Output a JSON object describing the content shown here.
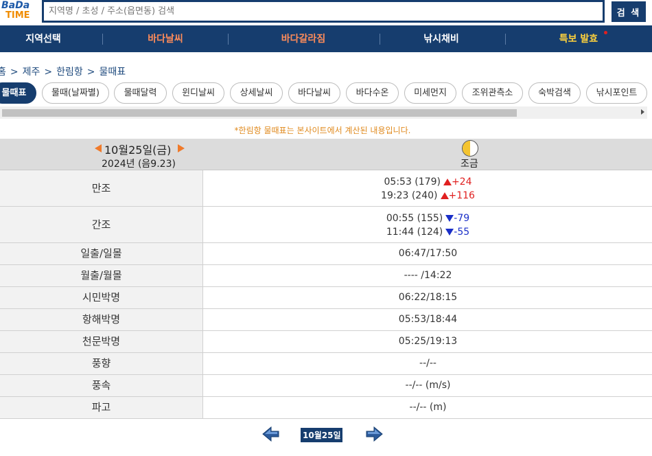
{
  "logo": {
    "line1": "BaDa",
    "line2": "TIME"
  },
  "search": {
    "placeholder": "지역명 / 초성 / 주소(읍면동) 검색",
    "button": "검 색"
  },
  "nav": {
    "items": [
      {
        "label": "지역선택",
        "color": "#ffffff"
      },
      {
        "label": "바다날씨",
        "color": "#ff8c5a"
      },
      {
        "label": "바다갈라짐",
        "color": "#ff8c5a"
      },
      {
        "label": "낚시채비",
        "color": "#ffffff"
      },
      {
        "label": "특보 발효",
        "color": "#ffd23c"
      }
    ]
  },
  "breadcrumb": [
    "홈",
    ">",
    "제주",
    ">",
    "한림항",
    ">",
    "물때표"
  ],
  "tabs": [
    "물때표",
    "물때(날짜별)",
    "물때달력",
    "윈디날씨",
    "상세날씨",
    "바다날씨",
    "바다수온",
    "미세먼지",
    "조위관측소",
    "숙박검색",
    "낚시포인트"
  ],
  "notice": "*한림항 물때표는 본사이트에서 계산된 내용입니다.",
  "date_header": {
    "date": "10월25일(금)",
    "sub": "2024년 (음9.23)",
    "moon_phase": "조금"
  },
  "tide": {
    "high_label": "만조",
    "high": [
      {
        "time": "05:53 (179)",
        "delta": "+24"
      },
      {
        "time": "19:23 (240)",
        "delta": "+116"
      }
    ],
    "low_label": "간조",
    "low": [
      {
        "time": "00:55 (155)",
        "delta": "-79"
      },
      {
        "time": "11:44 (124)",
        "delta": "-55"
      }
    ]
  },
  "rows": [
    {
      "label": "일출/일몰",
      "value": "06:47/17:50"
    },
    {
      "label": "월출/월몰",
      "value": "---- /14:22"
    },
    {
      "label": "시민박명",
      "value": "06:22/18:15"
    },
    {
      "label": "항해박명",
      "value": "05:53/18:44"
    },
    {
      "label": "천문박명",
      "value": "05:25/19:13"
    },
    {
      "label": "풍향",
      "value": "--/--"
    },
    {
      "label": "풍속",
      "value": "--/-- (m/s)"
    },
    {
      "label": "파고",
      "value": "--/-- (m)"
    }
  ],
  "bottom_nav": {
    "date": "10월25일"
  }
}
